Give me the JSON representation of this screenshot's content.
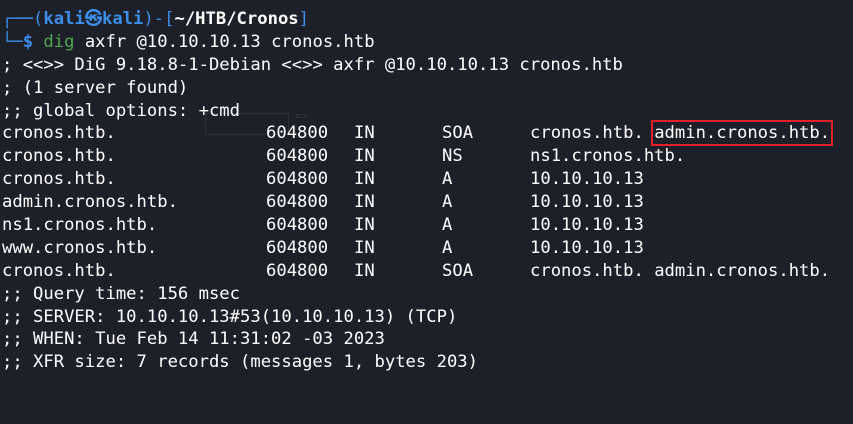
{
  "prompt": {
    "bracket_open": "┌──(",
    "user": "kali",
    "skull": "㉿",
    "host": "kali",
    "sep": ")-[",
    "cwd": "~/HTB/Cronos",
    "bracket_close": "]",
    "corner": "└─",
    "dollar": "$",
    "command_name": "dig",
    "command_args": " axfr @10.10.10.13 cronos.htb"
  },
  "header_lines": [
    "; <<>> DiG 9.18.8-1-Debian <<>> axfr @10.10.10.13 cronos.htb",
    "; (1 server found)",
    ";; global options: +cmd"
  ],
  "records": [
    {
      "name": "cronos.htb.",
      "ttl": "604800",
      "class": "IN",
      "type": "SOA",
      "data_a": "cronos.htb. ",
      "data_b": "admin.cronos.htb.",
      "highlighted": true
    },
    {
      "name": "cronos.htb.",
      "ttl": "604800",
      "class": "IN",
      "type": "NS",
      "data_a": "ns1.cronos.htb.",
      "data_b": "",
      "highlighted": false
    },
    {
      "name": "cronos.htb.",
      "ttl": "604800",
      "class": "IN",
      "type": "A",
      "data_a": "10.10.10.13",
      "data_b": "",
      "highlighted": false
    },
    {
      "name": "admin.cronos.htb.",
      "ttl": "604800",
      "class": "IN",
      "type": "A",
      "data_a": "10.10.10.13",
      "data_b": "",
      "highlighted": false
    },
    {
      "name": "ns1.cronos.htb.",
      "ttl": "604800",
      "class": "IN",
      "type": "A",
      "data_a": "10.10.10.13",
      "data_b": "",
      "highlighted": false
    },
    {
      "name": "www.cronos.htb.",
      "ttl": "604800",
      "class": "IN",
      "type": "A",
      "data_a": "10.10.10.13",
      "data_b": "",
      "highlighted": false
    },
    {
      "name": "cronos.htb.",
      "ttl": "604800",
      "class": "IN",
      "type": "SOA",
      "data_a": "cronos.htb. ",
      "data_b": "admin.cronos.htb.",
      "highlighted": false
    }
  ],
  "footer_lines": [
    ";; Query time: 156 msec",
    ";; SERVER: 10.10.10.13#53(10.10.10.13) (TCP)",
    ";; WHEN: Tue Feb 14 11:31:02 -03 2023",
    ";; XFR size: 7 records (messages 1, bytes 203)"
  ],
  "colors": {
    "background": "#1e2029",
    "prompt_blue": "#3b8eea",
    "command_green": "#4ea64e",
    "highlight_red": "#e0202a"
  }
}
